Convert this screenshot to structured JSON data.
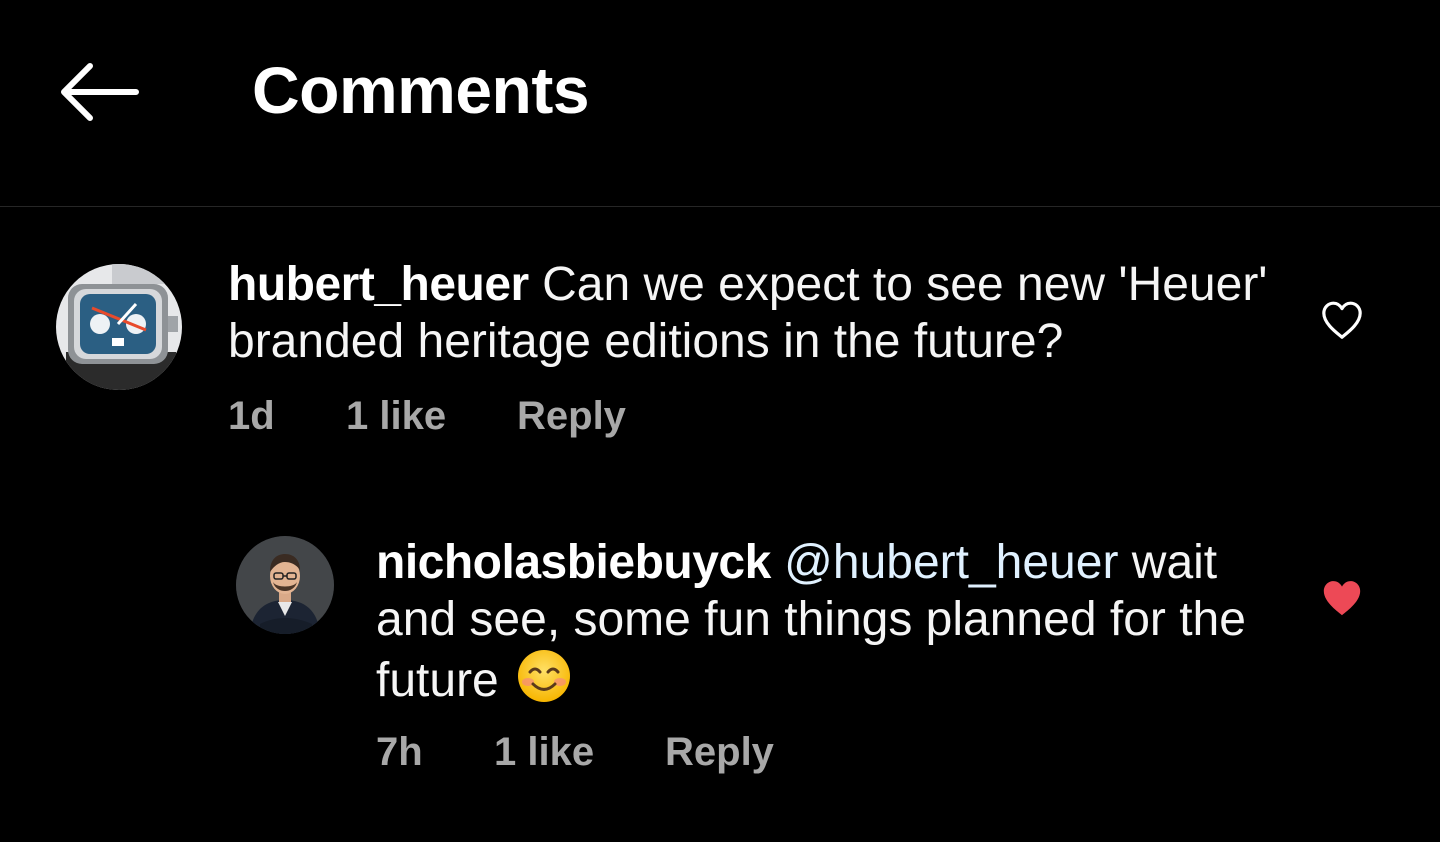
{
  "header": {
    "title": "Comments",
    "back_icon": "arrow-left-icon"
  },
  "comments": [
    {
      "username": "hubert_heuer",
      "text": "Can we expect to see new 'Heuer' branded heritage editions in the future?",
      "time": "1d",
      "likes": "1 like",
      "reply": "Reply",
      "liked": false,
      "like_icon": "heart-outline-icon"
    },
    {
      "username": "nicholasbiebuyck",
      "mention": "@hubert_heuer",
      "text_line1": "wait",
      "text_line2": "and see, some fun things planned for the",
      "text_line3": "future",
      "emoji": "smiling-face-icon",
      "time": "7h",
      "likes": "1 like",
      "reply": "Reply",
      "liked": true,
      "like_icon": "heart-filled-icon",
      "like_color": "#ed4956"
    }
  ]
}
